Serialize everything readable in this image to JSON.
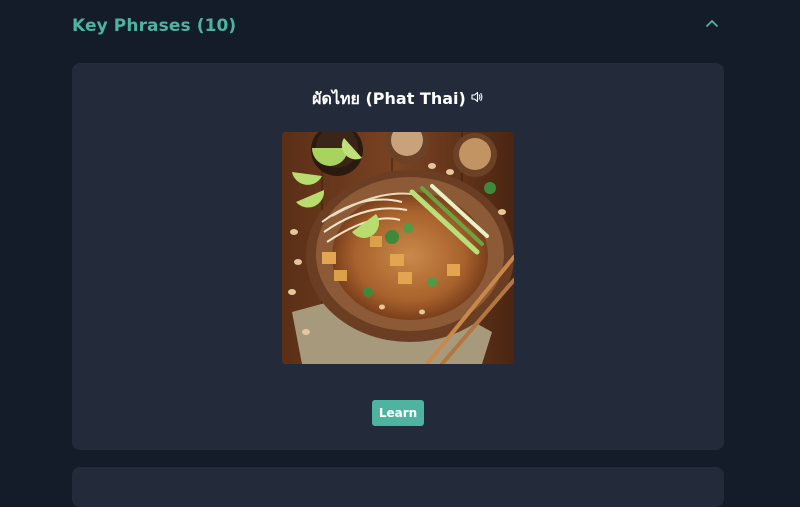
{
  "section": {
    "title": "Key Phrases (10)"
  },
  "phrase": {
    "text": "ผัดไทย (Phat Thai)",
    "audio_icon": "speaker-icon",
    "image_subject": "pad-thai"
  },
  "actions": {
    "learn_label": "Learn"
  },
  "colors": {
    "background": "#141b29",
    "card": "#232b3b",
    "accent": "#4fb3a2",
    "text": "#ffffff"
  }
}
